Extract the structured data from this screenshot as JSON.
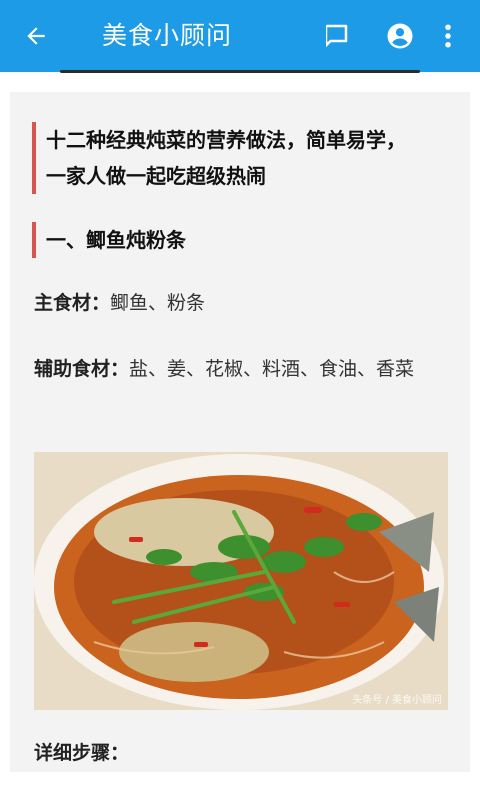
{
  "appbar": {
    "title": "美食小顾问",
    "back_icon": "arrow-back-icon",
    "comment_icon": "comment-icon",
    "account_icon": "account-circle-icon",
    "more_icon": "more-vert-icon",
    "color": "#1e9be6"
  },
  "article": {
    "heading": "十二种经典炖菜的营养做法，简单易学，一家人做一起吃超级热闹",
    "section1_title": "一、鲫鱼炖粉条",
    "main_ingredients_label": "主食材：",
    "main_ingredients_value": "鲫鱼、粉条",
    "aux_ingredients_label": "辅助食材：",
    "aux_ingredients_value": "盐、姜、花椒、料酒、食油、香菜",
    "photo_watermark": "头条号 / 美食小顾问",
    "steps_label": "详细步骤：",
    "accent_color": "#d9534f"
  }
}
